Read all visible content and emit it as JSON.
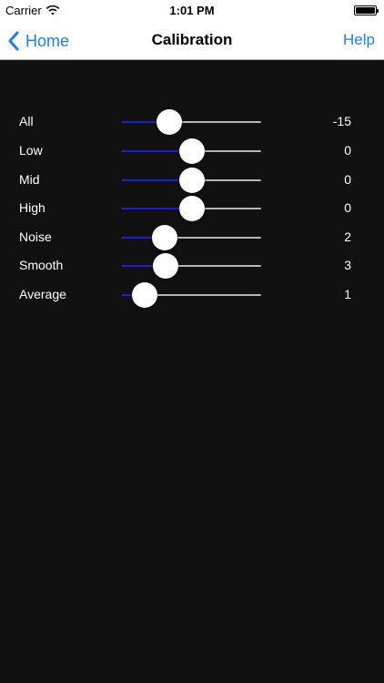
{
  "status_bar": {
    "carrier": "Carrier",
    "time": "1:01 PM",
    "wifi_icon": "wifi-icon",
    "battery_icon": "battery-icon"
  },
  "nav_bar": {
    "back_label": "Home",
    "back_icon": "chevron-left-icon",
    "title": "Calibration",
    "help_label": "Help"
  },
  "colors": {
    "accent": "#1a7ef5",
    "slider_fill": "#1a1fd6",
    "slider_track": "#b7b7b7",
    "background": "#111111"
  },
  "sliders": [
    {
      "label": "All",
      "value": "-15",
      "level": 0.3
    },
    {
      "label": "Low",
      "value": "0",
      "level": 0.5
    },
    {
      "label": "Mid",
      "value": "0",
      "level": 0.5
    },
    {
      "label": "High",
      "value": "0",
      "level": 0.5
    },
    {
      "label": "Noise",
      "value": "2",
      "level": 0.26
    },
    {
      "label": "Smooth",
      "value": "3",
      "level": 0.27
    },
    {
      "label": "Average",
      "value": "1",
      "level": 0.09
    }
  ]
}
